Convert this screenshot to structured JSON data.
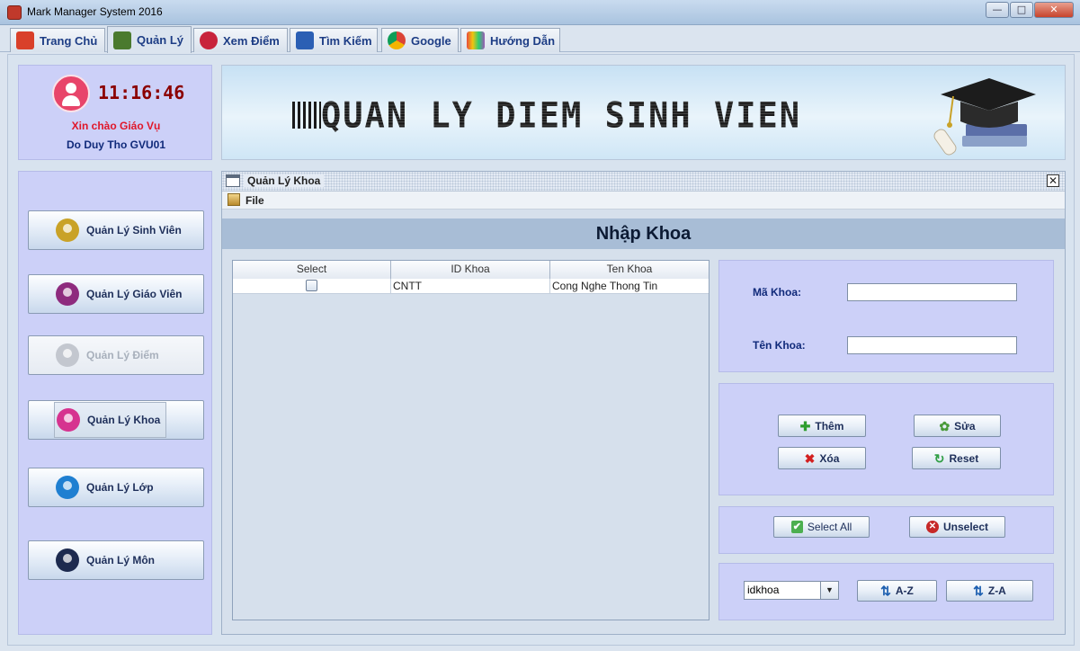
{
  "window": {
    "title": "Mark Manager System 2016",
    "minimize": "—",
    "maximize": "□",
    "close": "✕"
  },
  "tabs": [
    {
      "label": "Trang Chủ",
      "icon": "home-icon",
      "color": "#d9402a"
    },
    {
      "label": "Quản Lý",
      "icon": "manage-icon",
      "color": "#4a7a2e",
      "active": true
    },
    {
      "label": "Xem Điểm",
      "icon": "view-icon",
      "color": "#c8233b"
    },
    {
      "label": "Tìm Kiếm",
      "icon": "search-icon",
      "color": "#2b5fb4"
    },
    {
      "label": "Google",
      "icon": "chrome-icon",
      "color": "#2f9e44"
    },
    {
      "label": "Hướng Dẫn",
      "icon": "guide-icon",
      "color": "#9b59b6"
    }
  ],
  "user": {
    "clock": "11:16:46",
    "greeting": "Xin chào Giáo Vụ",
    "name": "Do Duy Tho GVU01"
  },
  "banner": {
    "title": "QUAN LY DIEM SINH VIEN"
  },
  "sidebar": {
    "items": [
      {
        "label": "Quản Lý Sinh Viên",
        "icon": "student-icon",
        "color": "#c9a227"
      },
      {
        "label": "Quản Lý Giáo Viên",
        "icon": "teacher-icon",
        "color": "#8e2b7e"
      },
      {
        "label": "Quản Lý Điểm",
        "icon": "grade-icon",
        "color": "#c3c7cf",
        "disabled": true
      },
      {
        "label": "Quản Lý Khoa",
        "icon": "faculty-icon",
        "color": "#d6338f",
        "pressed": true
      },
      {
        "label": "Quản Lý Lớp",
        "icon": "class-icon",
        "color": "#1f7fd1"
      },
      {
        "label": "Quản Lý Môn",
        "icon": "subject-icon",
        "color": "#1d2a4f"
      }
    ]
  },
  "frame": {
    "title": "Quản Lý Khoa",
    "menu_file": "File",
    "heading": "Nhập Khoa",
    "close": "✕"
  },
  "table": {
    "columns": [
      "Select",
      "ID Khoa",
      "Ten Khoa"
    ],
    "rows": [
      {
        "selected": false,
        "id": "CNTT",
        "name": "Cong Nghe Thong Tin"
      }
    ]
  },
  "form": {
    "ma_khoa_label": "Mã Khoa:",
    "ma_khoa_value": "",
    "ten_khoa_label": "Tên Khoa:",
    "ten_khoa_value": ""
  },
  "actions": {
    "them": "Thêm",
    "sua": "Sửa",
    "xoa": "Xóa",
    "reset": "Reset"
  },
  "selection": {
    "select_all": "Select All",
    "unselect": "Unselect"
  },
  "sort": {
    "field": "idkhoa",
    "asc": "A-Z",
    "desc": "Z-A"
  },
  "colors": {
    "panel": "#ccd0f8",
    "heading_bg": "#a8bdd6",
    "label": "#102a7a",
    "greeting": "#e0172a",
    "clock": "#8b0000"
  }
}
